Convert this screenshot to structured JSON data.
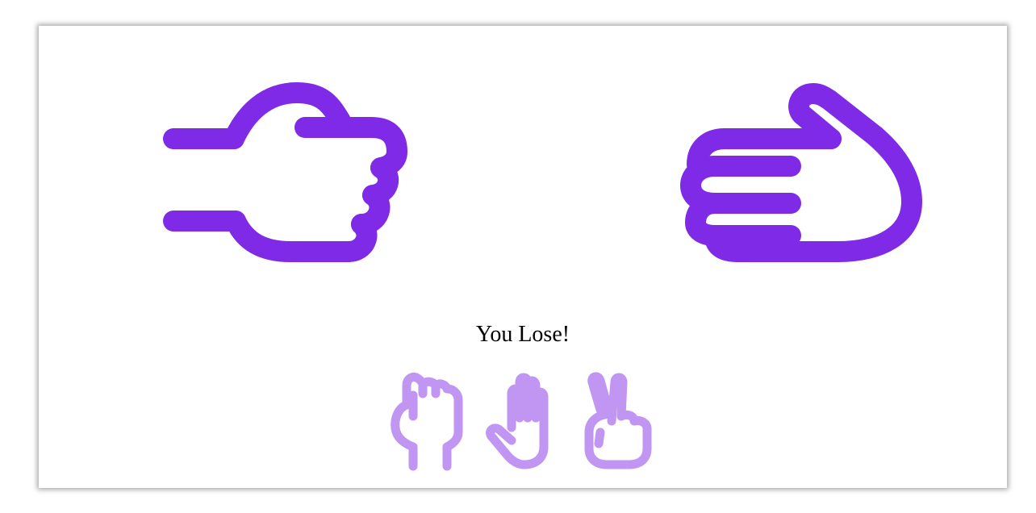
{
  "game": {
    "result_text": "You Lose!",
    "player_choice": "rock",
    "computer_choice": "paper",
    "choices": [
      "rock",
      "paper",
      "scissors"
    ]
  },
  "colors": {
    "hand_primary": "#7e2ae6",
    "choice_light": "#c196f2",
    "background": "#ffffff",
    "text": "#000000"
  },
  "icons": {
    "player_hand": "fist-pointing-right-icon",
    "computer_hand": "open-hand-pointing-left-icon",
    "rock": "fist-icon",
    "paper": "raised-hand-icon",
    "scissors": "victory-hand-icon"
  }
}
